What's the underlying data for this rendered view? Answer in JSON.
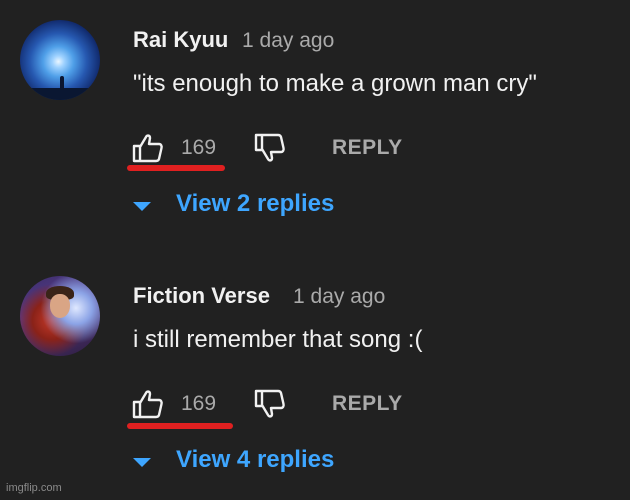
{
  "comments": [
    {
      "author": "Rai Kyuu",
      "time": "1 day ago",
      "text": "\"its enough to make a grown man cry\"",
      "likes": "169",
      "reply_label": "REPLY",
      "view_replies": "View 2 replies"
    },
    {
      "author": "Fiction Verse",
      "time": "1 day ago",
      "text": "i still remember that song :(",
      "likes": "169",
      "reply_label": "REPLY",
      "view_replies": "View 4 replies"
    }
  ],
  "watermark": "imgflip.com",
  "colors": {
    "background": "#212121",
    "link_blue": "#3ea6ff",
    "muted_gray": "#aaaaaa",
    "highlight_red": "#e02020"
  },
  "icons": [
    "thumbs-up-icon",
    "thumbs-down-icon",
    "caret-down-icon"
  ]
}
